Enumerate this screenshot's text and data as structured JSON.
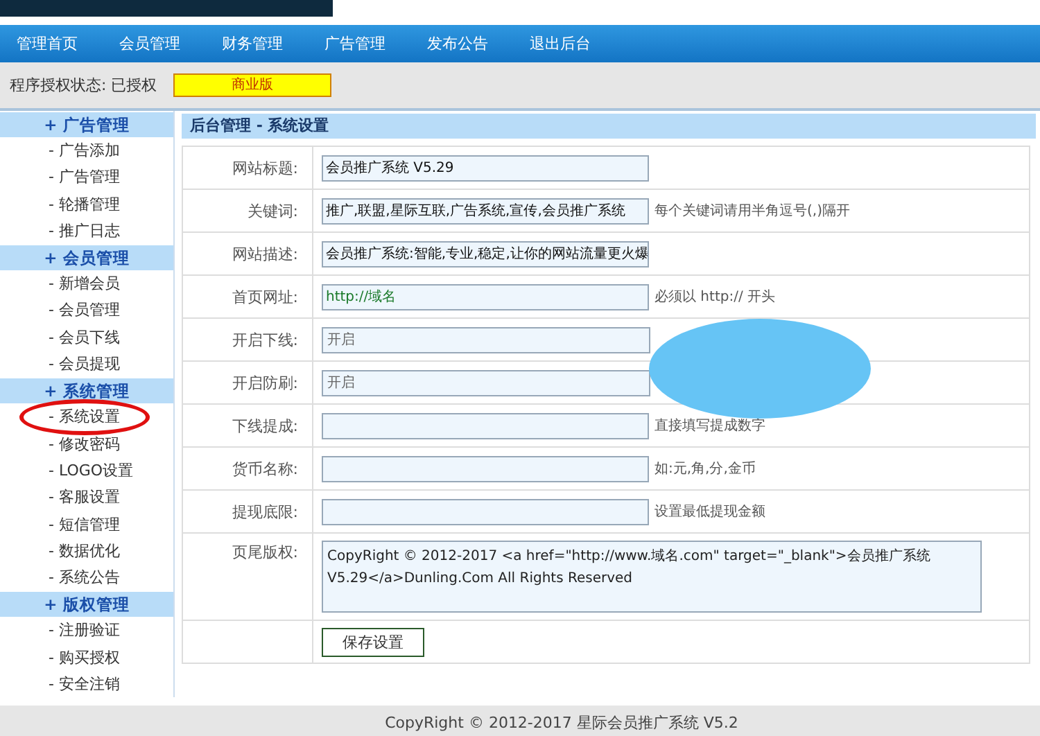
{
  "nav": [
    {
      "label": "管理首页",
      "selected": false
    },
    {
      "label": "会员管理",
      "selected": false
    },
    {
      "label": "财务管理",
      "selected": false
    },
    {
      "label": "广告管理",
      "selected": false
    },
    {
      "label": "发布公告",
      "selected": false
    },
    {
      "label": "退出后台",
      "selected": false
    }
  ],
  "license": {
    "label": "程序授权状态: 已授权",
    "badge": "商业版"
  },
  "sidebar": [
    {
      "title": "+ 广告管理",
      "children": [
        "- 广告添加",
        "- 广告管理",
        "- 轮播管理",
        "- 推广日志"
      ]
    },
    {
      "title": "+ 会员管理",
      "children": [
        "- 新增会员",
        "- 会员管理",
        "- 会员下线",
        "- 会员提现"
      ]
    },
    {
      "title": "+ 系统管理",
      "children": [
        "- 系统设置",
        "- 修改密码",
        "- LOGO设置",
        "- 客服设置",
        "- 短信管理",
        "- 数据优化",
        "- 系统公告"
      ]
    },
    {
      "title": "+ 版权管理",
      "children": [
        "- 注册验证",
        "- 购买授权",
        "- 安全注销"
      ]
    }
  ],
  "panel_title": "后台管理 - 系统设置",
  "form": [
    {
      "kind": "input",
      "label": "网站标题:",
      "value": "会员推广系统 V5.29"
    },
    {
      "kind": "input",
      "label": "关键词:",
      "value": "推广,联盟,星际互联,广告系统,宣传,会员推广系统",
      "note": "每个关键词请用半角逗号(,)隔开"
    },
    {
      "kind": "input",
      "label": "网站描述:",
      "value": "会员推广系统:智能,专业,稳定,让你的网站流量更火爆"
    },
    {
      "kind": "url",
      "label": "首页网址:",
      "value": "http://域名",
      "note": "必须以 http:// 开头"
    },
    {
      "kind": "select",
      "label": "开启下线:",
      "value": "开启"
    },
    {
      "kind": "select",
      "label": "开启防刷:",
      "value": "开启"
    },
    {
      "kind": "input",
      "label": "下线提成:",
      "note": "直接填写提成数字"
    },
    {
      "kind": "input",
      "label": "货币名称:",
      "note": "如:元,角,分,金币"
    },
    {
      "kind": "input",
      "label": "提现底限:",
      "note": "设置最低提现金额"
    },
    {
      "kind": "textarea",
      "label": "页尾版权:",
      "value": "CopyRight © 2012-2017 <a href=\"http://www.域名.com\" target=\"_blank\">会员推广系统 V5.29</a>Dunling.Com All Rights Reserved"
    }
  ],
  "save_button": "保存设置",
  "footer": "CopyRight © 2012-2017 星际会员推广系统 V5.2"
}
